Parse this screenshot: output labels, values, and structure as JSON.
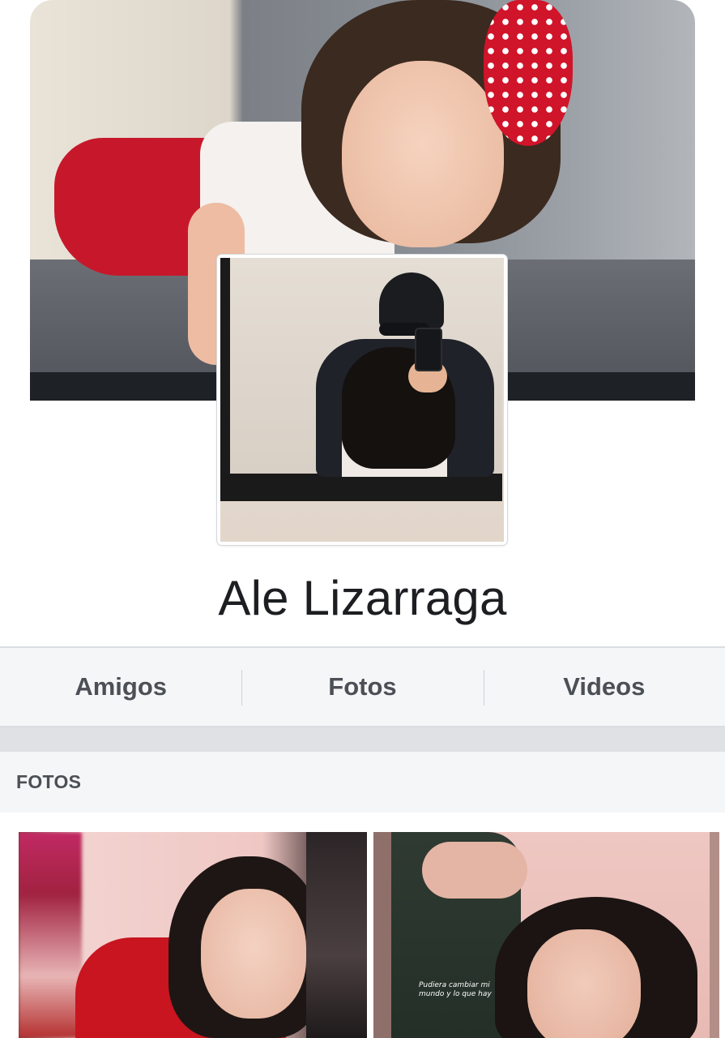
{
  "profile": {
    "name": "Ale Lizarraga"
  },
  "tabs": [
    {
      "label": "Amigos"
    },
    {
      "label": "Fotos"
    },
    {
      "label": "Videos"
    }
  ],
  "photos_section": {
    "header": "FOTOS",
    "items": [
      {
        "caption": ""
      },
      {
        "caption": "Pudiera cambiar mi mundo y lo que hay"
      }
    ]
  },
  "colors": {
    "tab_text": "#4b4f56",
    "name_text": "#1c1e21",
    "tab_bar_bg": "#f5f6f7",
    "cover_bar": "#1e2126"
  }
}
